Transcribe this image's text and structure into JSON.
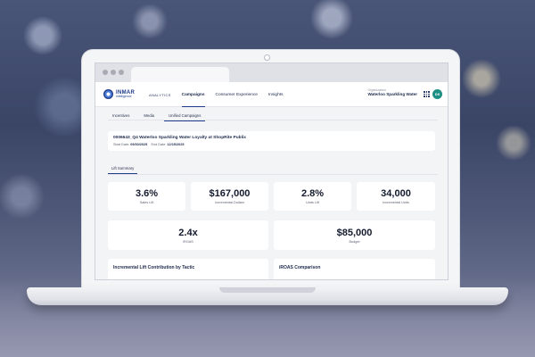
{
  "browser": {
    "tab_count": 1
  },
  "app": {
    "logo": {
      "name": "INMAR",
      "sub": "intelligence"
    },
    "nav": [
      {
        "label": "ANALYTICS",
        "active": false
      },
      {
        "label": "Campaigns",
        "active": true
      },
      {
        "label": "Consumer Experience",
        "active": false
      },
      {
        "label": "Insights",
        "active": false
      }
    ],
    "org": {
      "label": "Organization",
      "value": "Waterloo Sparkling Water"
    },
    "avatar_initials": "DS",
    "accent": "#1f3d8c",
    "avatar_color": "#1e8f84"
  },
  "subtabs": [
    {
      "label": "Incentives",
      "active": false
    },
    {
      "label": "Media",
      "active": false
    },
    {
      "label": "Unified Campaigns",
      "active": true
    }
  ],
  "campaign": {
    "title": "0006643_Q4 Waterloo Sparkling Water Loyalty at ShopRite Publix",
    "start_label": "Start Date:",
    "start_value": "09/30/2025",
    "end_label": "End Date:",
    "end_value": "12/15/2025"
  },
  "lift_tab": "Lift Summary",
  "metrics_row1": [
    {
      "value": "3.6%",
      "label": "Sales Lift"
    },
    {
      "value": "$167,000",
      "label": "Incremental Dollars"
    },
    {
      "value": "2.8%",
      "label": "Units Lift"
    },
    {
      "value": "34,000",
      "label": "Incremental Units"
    }
  ],
  "metrics_row2": [
    {
      "value": "2.4x",
      "label": "iROAS"
    },
    {
      "value": "$85,000",
      "label": "Budget"
    }
  ],
  "sections": [
    {
      "title": "Incremental Lift Contribution by Tactic"
    },
    {
      "title": "iROAS Comparison"
    }
  ]
}
